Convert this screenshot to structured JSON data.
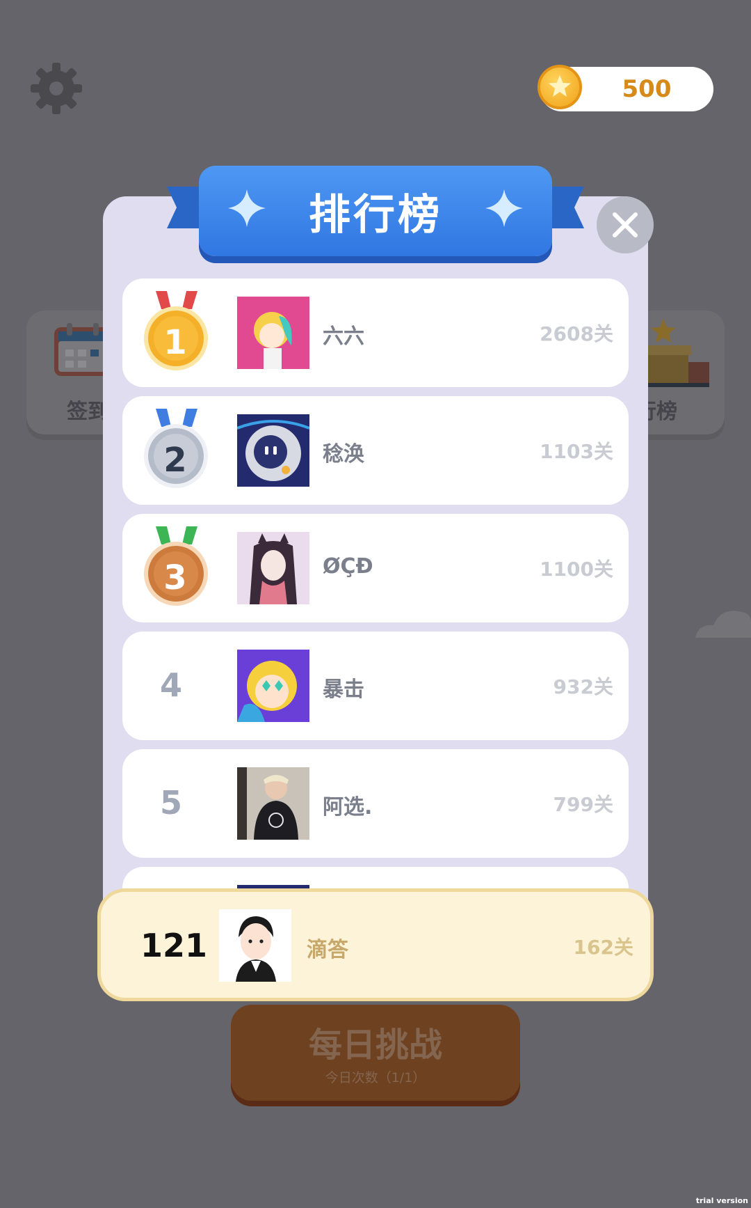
{
  "header": {
    "coins": "500"
  },
  "background": {
    "left_card_label": "签到",
    "right_card_label": "排行榜",
    "daily_challenge": {
      "title": "每日挑战",
      "subtitle": "今日次数（1/1）"
    }
  },
  "leaderboard": {
    "title": "排行榜",
    "entries": [
      {
        "rank": "1",
        "name": "六六",
        "score": "2608关"
      },
      {
        "rank": "2",
        "name": "稔涣",
        "score": "1103关"
      },
      {
        "rank": "3",
        "name": "ØÇĐ",
        "score": "1100关"
      },
      {
        "rank": "4",
        "name": "暴击",
        "score": "932关"
      },
      {
        "rank": "5",
        "name": "阿选.",
        "score": "799关"
      }
    ],
    "me": {
      "rank": "121",
      "name": "滴答",
      "score": "162关"
    }
  },
  "watermark": "trial version",
  "colors": {
    "gold": "#f5b02a",
    "silver": "#c7ccd6",
    "bronze": "#d8894a",
    "banner": "#3f88ec",
    "panel": "#e0ddf0"
  }
}
